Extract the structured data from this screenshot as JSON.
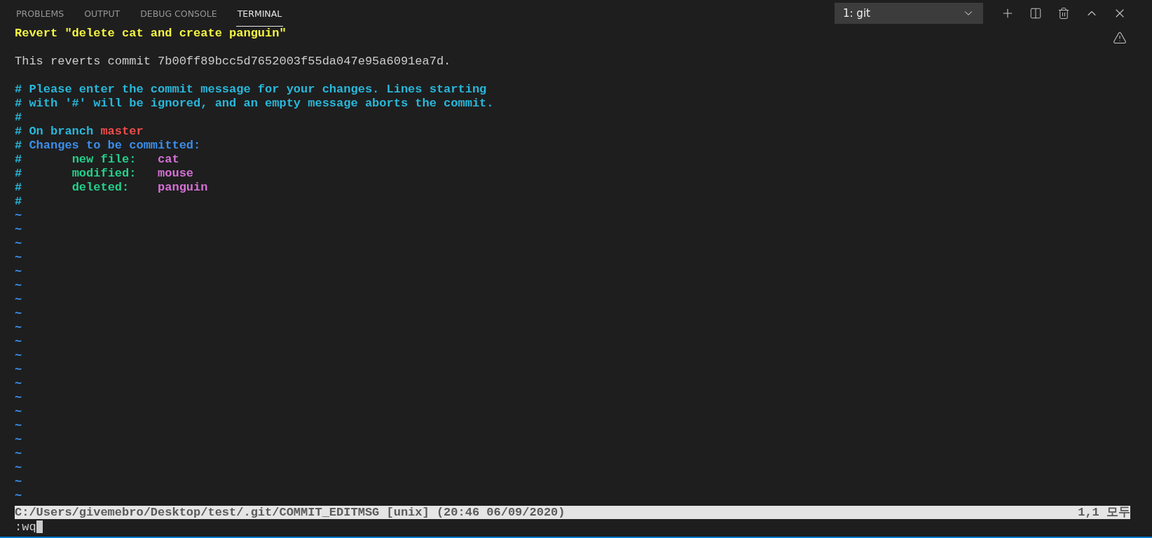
{
  "tabs": [
    {
      "label": "PROBLEMS",
      "selected": false
    },
    {
      "label": "OUTPUT",
      "selected": false
    },
    {
      "label": "DEBUG CONSOLE",
      "selected": false
    },
    {
      "label": "TERMINAL",
      "selected": true
    }
  ],
  "terminal_select": {
    "value": "1: git"
  },
  "lines": [
    {
      "kind": "text",
      "segments": [
        {
          "kind": "heading",
          "text": "Revert \"delete cat and create panguin\""
        }
      ]
    },
    {
      "kind": "blank"
    },
    {
      "kind": "text",
      "segments": [
        {
          "kind": "text",
          "text": "This reverts commit 7b00ff89bcc5d7652003f55da047e95a6091ea7d."
        }
      ]
    },
    {
      "kind": "blank"
    },
    {
      "kind": "text",
      "segments": [
        {
          "kind": "comment",
          "text": "# Please enter the commit message for your changes. Lines starting"
        }
      ]
    },
    {
      "kind": "text",
      "segments": [
        {
          "kind": "comment",
          "text": "# with '#' will be ignored, and an empty message aborts the commit."
        }
      ]
    },
    {
      "kind": "text",
      "segments": [
        {
          "kind": "comment",
          "text": "#"
        }
      ]
    },
    {
      "kind": "text",
      "segments": [
        {
          "kind": "comment",
          "text": "# On branch "
        },
        {
          "kind": "branch",
          "text": "master"
        }
      ]
    },
    {
      "kind": "text",
      "segments": [
        {
          "kind": "comment",
          "text": "# "
        },
        {
          "kind": "section",
          "text": "Changes to be committed:"
        }
      ]
    },
    {
      "kind": "text",
      "segments": [
        {
          "kind": "comment",
          "text": "#       "
        },
        {
          "kind": "status",
          "text": "new file:   "
        },
        {
          "kind": "filename",
          "text": "cat"
        }
      ]
    },
    {
      "kind": "text",
      "segments": [
        {
          "kind": "comment",
          "text": "#       "
        },
        {
          "kind": "status",
          "text": "modified:   "
        },
        {
          "kind": "filename",
          "text": "mouse"
        }
      ]
    },
    {
      "kind": "text",
      "segments": [
        {
          "kind": "comment",
          "text": "#       "
        },
        {
          "kind": "status",
          "text": "deleted:    "
        },
        {
          "kind": "filename",
          "text": "panguin"
        }
      ]
    },
    {
      "kind": "text",
      "segments": [
        {
          "kind": "comment",
          "text": "#"
        }
      ]
    },
    {
      "kind": "tilde",
      "segments": [
        {
          "kind": "tilde",
          "text": "~"
        }
      ]
    },
    {
      "kind": "tilde",
      "segments": [
        {
          "kind": "tilde",
          "text": "~"
        }
      ]
    },
    {
      "kind": "tilde",
      "segments": [
        {
          "kind": "tilde",
          "text": "~"
        }
      ]
    },
    {
      "kind": "tilde",
      "segments": [
        {
          "kind": "tilde",
          "text": "~"
        }
      ]
    },
    {
      "kind": "tilde",
      "segments": [
        {
          "kind": "tilde",
          "text": "~"
        }
      ]
    },
    {
      "kind": "tilde",
      "segments": [
        {
          "kind": "tilde",
          "text": "~"
        }
      ]
    },
    {
      "kind": "tilde",
      "segments": [
        {
          "kind": "tilde",
          "text": "~"
        }
      ]
    },
    {
      "kind": "tilde",
      "segments": [
        {
          "kind": "tilde",
          "text": "~"
        }
      ]
    },
    {
      "kind": "tilde",
      "segments": [
        {
          "kind": "tilde",
          "text": "~"
        }
      ]
    },
    {
      "kind": "tilde",
      "segments": [
        {
          "kind": "tilde",
          "text": "~"
        }
      ]
    },
    {
      "kind": "tilde",
      "segments": [
        {
          "kind": "tilde",
          "text": "~"
        }
      ]
    },
    {
      "kind": "tilde",
      "segments": [
        {
          "kind": "tilde",
          "text": "~"
        }
      ]
    },
    {
      "kind": "tilde",
      "segments": [
        {
          "kind": "tilde",
          "text": "~"
        }
      ]
    },
    {
      "kind": "tilde",
      "segments": [
        {
          "kind": "tilde",
          "text": "~"
        }
      ]
    },
    {
      "kind": "tilde",
      "segments": [
        {
          "kind": "tilde",
          "text": "~"
        }
      ]
    },
    {
      "kind": "tilde",
      "segments": [
        {
          "kind": "tilde",
          "text": "~"
        }
      ]
    },
    {
      "kind": "tilde",
      "segments": [
        {
          "kind": "tilde",
          "text": "~"
        }
      ]
    },
    {
      "kind": "tilde",
      "segments": [
        {
          "kind": "tilde",
          "text": "~"
        }
      ]
    },
    {
      "kind": "tilde",
      "segments": [
        {
          "kind": "tilde",
          "text": "~"
        }
      ]
    },
    {
      "kind": "tilde",
      "segments": [
        {
          "kind": "tilde",
          "text": "~"
        }
      ]
    },
    {
      "kind": "tilde",
      "segments": [
        {
          "kind": "tilde",
          "text": "~"
        }
      ]
    }
  ],
  "status_bar": {
    "file": "C:/Users/givemebro/Desktop/test/.git/COMMIT_EDITMSG [unix] (20:46 06/09/2020)",
    "position": "1,1 모두"
  },
  "command_line": {
    "value": ":wq"
  }
}
